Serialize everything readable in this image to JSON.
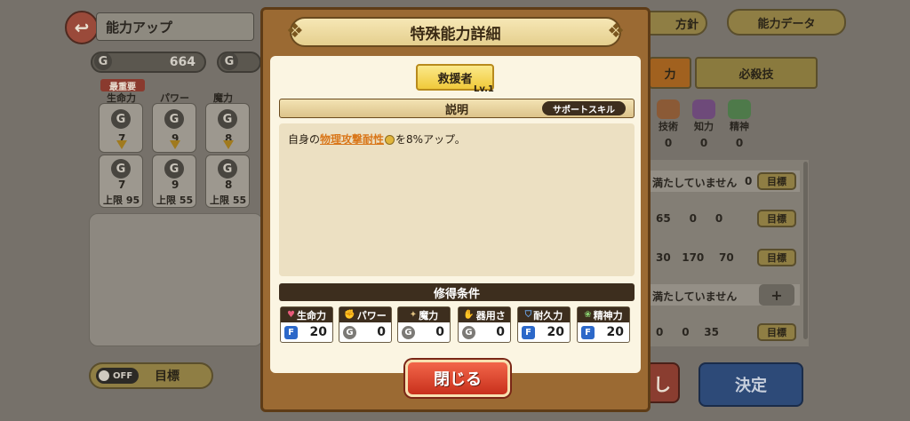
{
  "bg": {
    "header_title": "能力アップ",
    "gold_value": "664",
    "coin_letter": "G",
    "top_right_buttons": [
      "方針",
      "能力データ"
    ],
    "tabs": [
      "力",
      "必殺技"
    ],
    "priority_label": "最重要",
    "stat_cards": [
      {
        "label": "生命力",
        "value": "7",
        "next": "7",
        "limit": "上限 95"
      },
      {
        "label": "パワー",
        "value": "9",
        "next": "9",
        "limit": "上限 55"
      },
      {
        "label": "魔力",
        "value": "8",
        "next": "8",
        "limit": "上限 55"
      }
    ],
    "right_stats": [
      {
        "label": "技術",
        "value": "0"
      },
      {
        "label": "知力",
        "value": "0"
      },
      {
        "label": "精神",
        "value": "0"
      }
    ],
    "rows": [
      {
        "text": "満たしていません",
        "value": "0",
        "btn": "目標"
      },
      {
        "text": "65     0     0",
        "btn": "目標"
      },
      {
        "text": "30   170    70",
        "btn": "目標"
      },
      {
        "text": "満たしていません",
        "btn": ""
      },
      {
        "text": "0     0    35",
        "btn": "目標"
      }
    ],
    "toggle_off": "OFF",
    "toggle_label": "目標",
    "partial_button": "し",
    "confirm_button": "決定"
  },
  "modal": {
    "title": "特殊能力詳細",
    "skill_name": "救援者",
    "skill_level": "Lv.1",
    "description_header": "説明",
    "category": "サポートスキル",
    "desc_prefix": "自身の",
    "desc_keyword": "物理攻撃耐性",
    "desc_suffix": "を8%アップ。",
    "conditions_header": "修得条件",
    "conditions": [
      {
        "label": "生命力",
        "rank": "F",
        "value": "20",
        "icon": "heart-icon"
      },
      {
        "label": "パワー",
        "rank": "G",
        "value": "0",
        "icon": "fist-icon"
      },
      {
        "label": "魔力",
        "rank": "G",
        "value": "0",
        "icon": "magic-icon"
      },
      {
        "label": "器用さ",
        "rank": "G",
        "value": "0",
        "icon": "hand-icon"
      },
      {
        "label": "耐久力",
        "rank": "F",
        "value": "20",
        "icon": "shield-icon"
      },
      {
        "label": "精神力",
        "rank": "F",
        "value": "20",
        "icon": "mind-icon"
      }
    ],
    "close_button": "閉じる"
  },
  "colors": {
    "accent_red": "#e0462a",
    "gold": "#f2d34a",
    "rank_f_blue": "#2c68c9",
    "keyword_orange": "#d9771a"
  }
}
